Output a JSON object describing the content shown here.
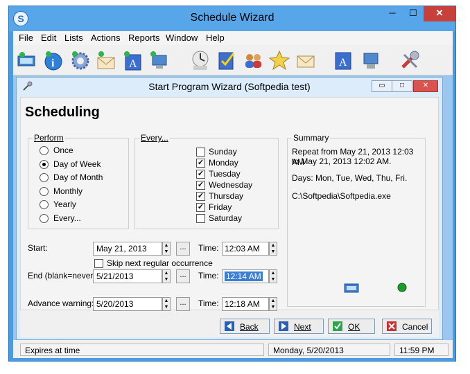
{
  "window": {
    "title": "Schedule Wizard",
    "app_icon_letter": "S",
    "controls": {
      "minimize": "─",
      "maximize": "☐",
      "close": "✕"
    }
  },
  "menu": [
    "File",
    "Edit",
    "Lists",
    "Actions",
    "Reports",
    "Window",
    "Help"
  ],
  "toolbar": {
    "icons": [
      "new-schedule-icon",
      "info-icon",
      "settings-gear-icon",
      "new-email-icon",
      "text-message-icon",
      "network-computer-icon",
      "clock-icon",
      "task-checklist-icon",
      "contacts-icon",
      "favorites-star-icon",
      "email-icon",
      "text-a-icon",
      "computer-icon",
      "tools-icon"
    ]
  },
  "child_window": {
    "title": "Start Program Wizard  (Softpedia test)",
    "controls": {
      "minimize": "▭",
      "maximize": "□",
      "close": "✕"
    }
  },
  "wizard": {
    "heading": "Scheduling",
    "perform": {
      "label": "Perform",
      "options": [
        "Once",
        "Day of Week",
        "Day of Month",
        "Monthly",
        "Yearly",
        "Every..."
      ],
      "selected": "Day of Week"
    },
    "every": {
      "label": "Every...",
      "days": [
        {
          "name": "Sunday",
          "checked": false
        },
        {
          "name": "Monday",
          "checked": true
        },
        {
          "name": "Tuesday",
          "checked": true
        },
        {
          "name": "Wednesday",
          "checked": true
        },
        {
          "name": "Thursday",
          "checked": true
        },
        {
          "name": "Friday",
          "checked": true
        },
        {
          "name": "Saturday",
          "checked": false
        }
      ]
    },
    "summary": {
      "label": "Summary",
      "line1": "Repeat from May 21, 2013 12:03 AM",
      "line2": "to May 21, 2013 12:02 AM.",
      "line3": "Days: Mon, Tue, Wed, Thu, Fri.",
      "line4": "C:\\Softpedia\\Softpedia.exe"
    },
    "start": {
      "label": "Start:",
      "date": "May 21, 2013",
      "time_label": "Time:",
      "time": "12:03 AM"
    },
    "skip": {
      "label": "Skip next regular occurrence",
      "checked": false
    },
    "end": {
      "label": "End (blank=never):",
      "date": "5/21/2013",
      "time_label": "Time:",
      "time": "12:14 AM"
    },
    "advance": {
      "label": "Advance warning:",
      "date": "5/20/2013",
      "time_label": "Time:",
      "time": "12:18 AM"
    },
    "ellipsis": "...",
    "checkmark": "✓",
    "buttons": {
      "back": "Back",
      "next": "Next",
      "ok": "OK",
      "cancel": "Cancel"
    }
  },
  "status": {
    "left": "Expires at time",
    "date": "Monday,  5/20/2013",
    "time": "11:59 PM"
  },
  "colors": {
    "titlebar": "#58a6ea",
    "mdi_bg": "#9bc6ef",
    "selection": "#3a7fd5"
  }
}
